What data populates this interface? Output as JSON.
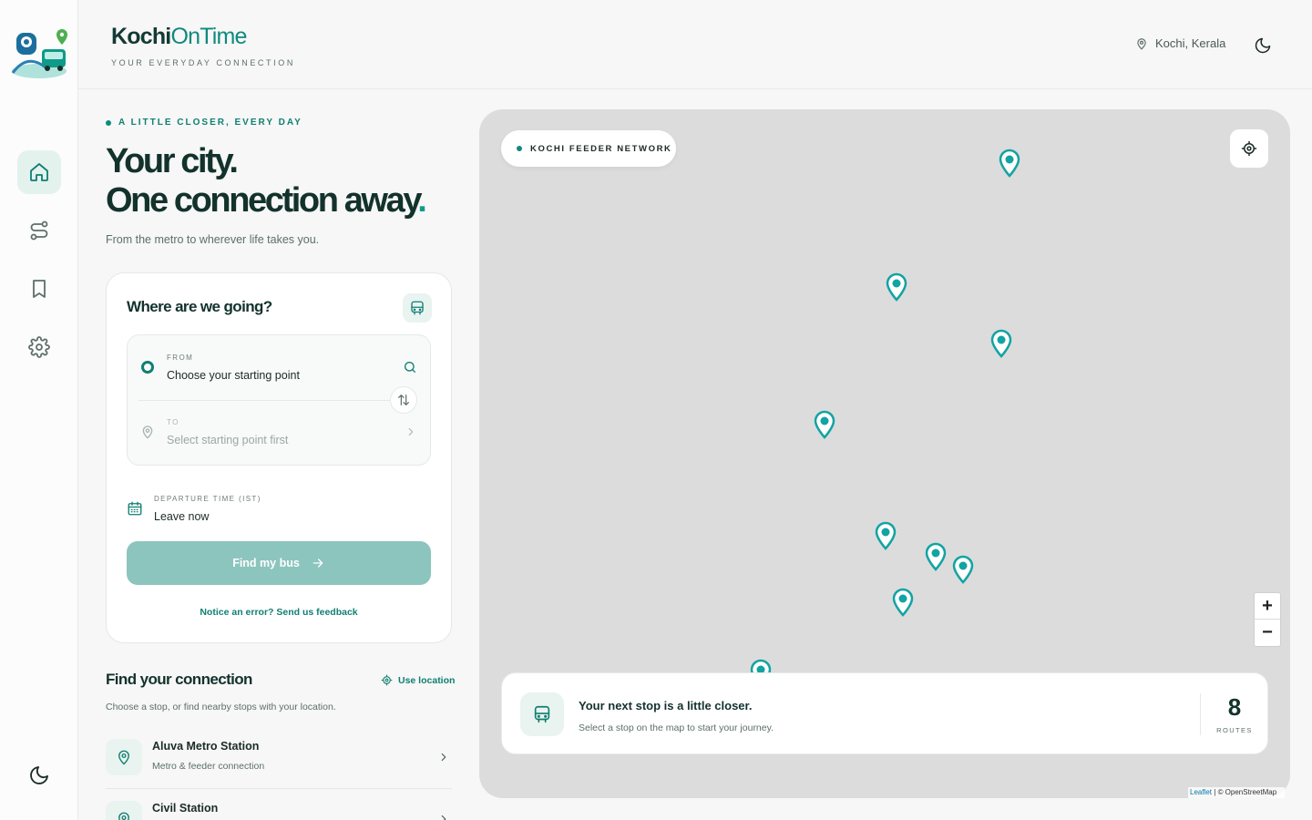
{
  "header": {
    "brand_part1": "Kochi",
    "brand_part2": "OnTime",
    "tagline": "YOUR EVERYDAY CONNECTION",
    "location": "Kochi, Kerala"
  },
  "sidebar": {
    "items": [
      {
        "name": "home",
        "icon": "home-icon",
        "active": true
      },
      {
        "name": "routes",
        "icon": "route-icon",
        "active": false
      },
      {
        "name": "saved",
        "icon": "bookmark-icon",
        "active": false
      },
      {
        "name": "settings",
        "icon": "gear-icon",
        "active": false
      }
    ]
  },
  "hero": {
    "kicker": "A LITTLE CLOSER, EVERY DAY",
    "line1": "Your city.",
    "line2": "One connection away",
    "line2_end": ".",
    "subtitle": "From the metro to wherever life takes you."
  },
  "planner": {
    "title": "Where are we going?",
    "from_label": "FROM",
    "from_value": "Choose your starting point",
    "to_label": "TO",
    "to_value": "Select starting point first",
    "departure_label": "DEPARTURE TIME (IST)",
    "departure_value": "Leave now",
    "submit_label": "Find my bus",
    "feedback_link": "Notice an error? Send us feedback"
  },
  "connections": {
    "title": "Find your connection",
    "use_location": "Use location",
    "subtitle": "Choose a stop, or find nearby stops with your location.",
    "stops": [
      {
        "name": "Aluva Metro Station",
        "desc": "Metro & feeder connection"
      },
      {
        "name": "Civil Station",
        "desc": ""
      }
    ]
  },
  "map": {
    "network_label": "KOCHI FEEDER NETWORK",
    "zoom_in": "+",
    "zoom_out": "−",
    "next_stop_title": "Your next stop is a little closer.",
    "next_stop_sub": "Select a stop on the map to start your journey.",
    "routes_count": "8",
    "routes_label": "ROUTES",
    "attribution_leaflet": "Leaflet",
    "attribution_osm": "| © OpenStreetMap"
  },
  "colors": {
    "accent": "#0f8a7e",
    "pin": "#12a3a3",
    "button_disabled": "#8cc5bd"
  }
}
